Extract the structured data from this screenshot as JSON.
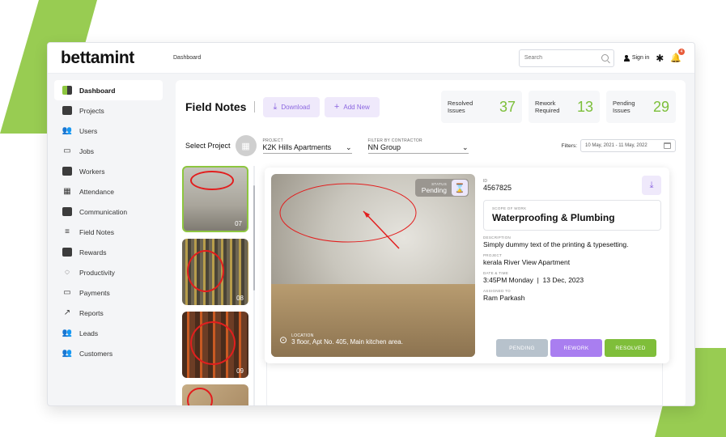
{
  "colors": {
    "accent": "#8dc63f",
    "purple": "#8b66e0",
    "stat_number": "#7cbf3a",
    "pending_btn": "#b7c2cc",
    "rework_btn": "#a97ef0",
    "resolved_btn": "#7fbe3a"
  },
  "app": {
    "logo": "bettamint",
    "breadcrumb": "Dashboard"
  },
  "topbar": {
    "search_placeholder": "Search",
    "signin_label": "Sign in",
    "notification_count": "4",
    "icons": [
      "search-icon",
      "user-icon",
      "gear-icon",
      "bell-icon"
    ]
  },
  "sidebar": {
    "items": [
      {
        "label": "Dashboard",
        "icon": "dashboard-icon",
        "active": true
      },
      {
        "label": "Projects",
        "icon": "clipboard-icon"
      },
      {
        "label": "Users",
        "icon": "users-icon"
      },
      {
        "label": "Jobs",
        "icon": "briefcase-icon"
      },
      {
        "label": "Workers",
        "icon": "worker-badge-icon"
      },
      {
        "label": "Attendance",
        "icon": "attendance-icon"
      },
      {
        "label": "Communication",
        "icon": "chat-icon"
      },
      {
        "label": "Field Notes",
        "icon": "list-icon"
      },
      {
        "label": "Rewards",
        "icon": "rewards-icon"
      },
      {
        "label": "Productivity",
        "icon": "productivity-icon"
      },
      {
        "label": "Payments",
        "icon": "card-icon"
      },
      {
        "label": "Reports",
        "icon": "trend-icon"
      },
      {
        "label": "Leads",
        "icon": "leads-icon"
      },
      {
        "label": "Customers",
        "icon": "customers-icon"
      }
    ]
  },
  "header": {
    "title": "Field Notes",
    "download_label": "Download",
    "add_new_label": "Add New",
    "stats": [
      {
        "label_line1": "Resolved",
        "label_line2": "Issues",
        "value": "37"
      },
      {
        "label_line1": "Rework",
        "label_line2": "Required",
        "value": "13"
      },
      {
        "label_line1": "Pending",
        "label_line2": "Issues",
        "value": "29"
      }
    ]
  },
  "filters": {
    "select_project_label": "Select Project",
    "project_caption": "PROJECT",
    "project_value": "K2K Hills Apartments",
    "contractor_caption": "FILTER BY CONTRACTOR",
    "contractor_value": "NN Group",
    "filters_label": "Filters:",
    "date_range": "10 May, 2021 - 11 May, 2022"
  },
  "thumbnails": [
    {
      "number": "07",
      "selected": true
    },
    {
      "number": "08",
      "selected": false
    },
    {
      "number": "09",
      "selected": false
    },
    {
      "number": "",
      "selected": false
    }
  ],
  "note": {
    "status_caption": "STATUS",
    "status_value": "Pending",
    "location_caption": "LOCATION",
    "location_value": "3 floor, Apt No. 405, Main kitchen area.",
    "id_caption": "ID",
    "id_value": "4567825",
    "scope_caption": "SCOPE OF WORK",
    "scope_value": "Waterproofing & Plumbing",
    "description_caption": "DESCRIPTION",
    "description_value": "Simply dummy text of the printing & typesetting.",
    "project_caption": "PROJECT",
    "project_value": "kerala River View Apartment",
    "datetime_caption": "DATE & TIME",
    "datetime_value": "3:45PM Monday  |  13 Dec, 2023",
    "assigned_caption": "ASSIGNED TO",
    "assigned_value": "Ram Parkash",
    "actions": {
      "pending": "PENDING",
      "rework": "REWORK",
      "resolved": "RESOLVED"
    }
  }
}
